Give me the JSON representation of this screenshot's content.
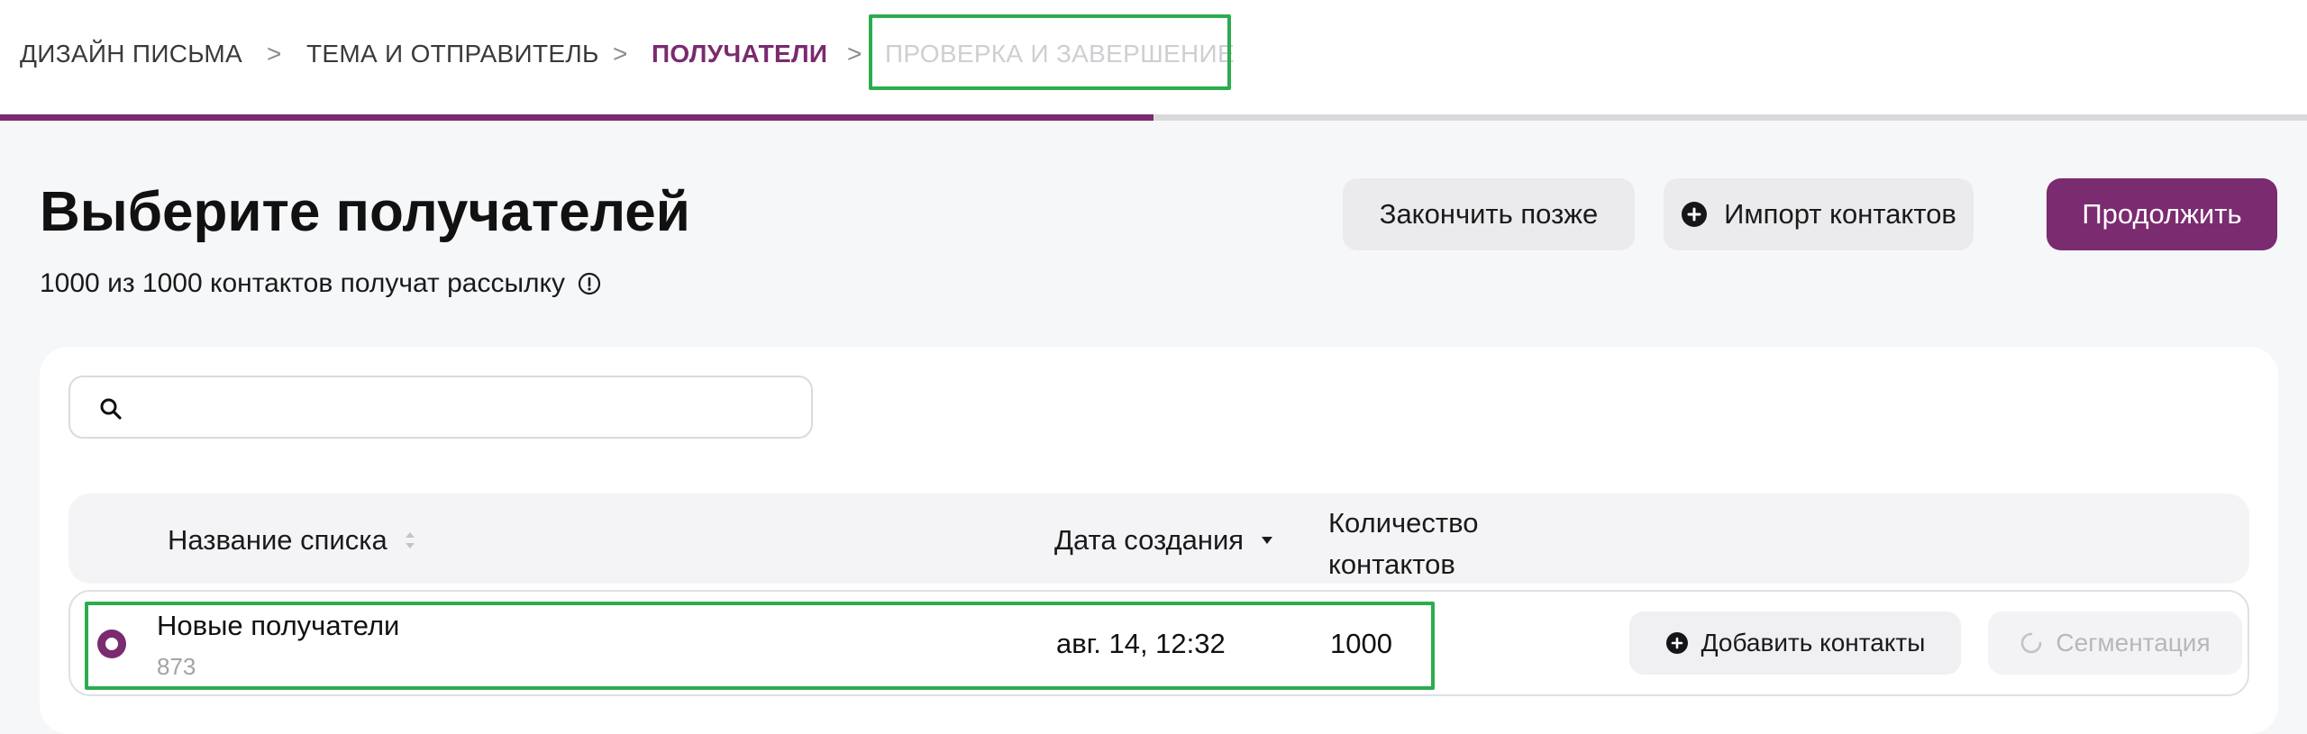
{
  "stepper": {
    "steps": [
      {
        "label": "ДИЗАЙН ПИСЬМА"
      },
      {
        "label": "ТЕМА И ОТПРАВИТЕЛЬ"
      },
      {
        "label": "ПОЛУЧАТЕЛИ"
      },
      {
        "label": "ПРОВЕРКА И ЗАВЕРШЕНИЕ"
      }
    ],
    "separator": ">",
    "active_index": 2,
    "progress_fraction": 0.5
  },
  "header": {
    "title": "Выберите получателей",
    "subtitle": "1000 из 1000 контактов получат рассылку",
    "finish_later_label": "Закончить позже",
    "import_label": "Импорт контактов",
    "continue_label": "Продолжить"
  },
  "search": {
    "value": "",
    "placeholder": ""
  },
  "table": {
    "columns": {
      "name": "Название списка",
      "date": "Дата создания",
      "count_line1": "Количество",
      "count_line2": "контактов"
    },
    "rows": [
      {
        "name": "Новые получатели",
        "id": "873",
        "date": "авг. 14, 12:32",
        "count": "1000",
        "selected": true,
        "add_label": "Добавить контакты",
        "segment_label": "Сегментация"
      }
    ]
  },
  "colors": {
    "accent": "#7b2b6f",
    "highlight": "#2cac4e",
    "muted": "#cfcfd3"
  }
}
